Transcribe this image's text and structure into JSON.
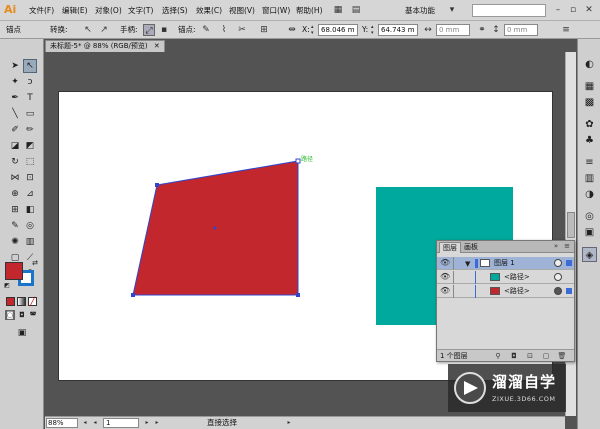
{
  "app": {
    "logo": "Ai",
    "workspace": "基本功能"
  },
  "menu": [
    "文件(F)",
    "编辑(E)",
    "对象(O)",
    "文字(T)",
    "选择(S)",
    "效果(C)",
    "视图(V)",
    "窗口(W)",
    "帮助(H)"
  ],
  "control": {
    "anchor_label": "锚点",
    "convert_label": "转换:",
    "handles_label": "手柄:",
    "anchors_label": "锚点:",
    "x_label": "X:",
    "x_value": "68.046 m",
    "y_label": "Y:",
    "y_value": "64.743 m",
    "w_value": "0 mm",
    "h_value": "0 mm"
  },
  "document": {
    "tab_title": "未标题-5* @ 88% (RGB/预览)",
    "fill_color": "#c1272d",
    "stroke_color": "#1a74c9"
  },
  "canvas": {
    "quad_color": "#c1272d",
    "quad_stroke": "#3344cc",
    "teal_color": "#00a99d",
    "path_hint": "路径"
  },
  "layers": {
    "tab_active": "图层",
    "tab_other": "画板",
    "rows": [
      {
        "name": "图层 1",
        "swatch": "#00a99d"
      },
      {
        "name": "<路径>",
        "swatch": "#00a99d"
      },
      {
        "name": "<路径>",
        "swatch": "#c1272d"
      }
    ],
    "count": "1 个图层"
  },
  "status": {
    "zoom": "88%",
    "page": "1",
    "tool": "直接选择"
  },
  "watermark": {
    "title": "溜溜自学",
    "url": "ZIXUE.3D66.COM"
  }
}
